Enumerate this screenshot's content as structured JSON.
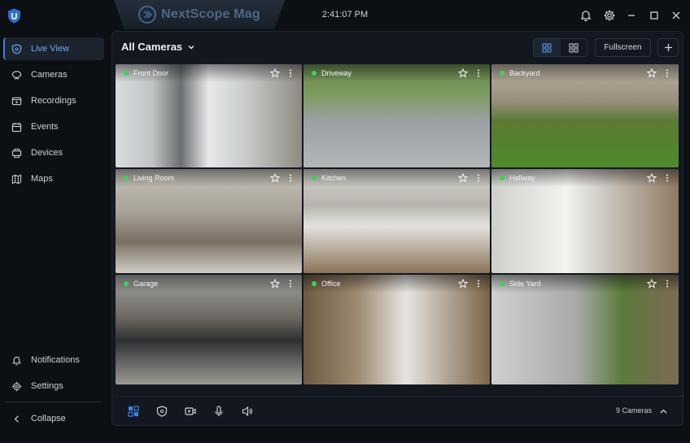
{
  "app": {
    "brand_name": "NextScope Mag",
    "clock": "2:41:07 PM",
    "accent": "#3e84e6",
    "status_online_color": "#3fd15a"
  },
  "topbar": {
    "icons": [
      "bell-icon",
      "gear-icon",
      "minimize-icon",
      "maximize-icon",
      "close-icon"
    ]
  },
  "sidebar": {
    "items": [
      {
        "label": "Live View",
        "icon": "shield-icon",
        "active": true
      },
      {
        "label": "Cameras",
        "icon": "camera-icon"
      },
      {
        "label": "Recordings",
        "icon": "recordings-icon"
      },
      {
        "label": "Events",
        "icon": "events-icon"
      },
      {
        "label": "Devices",
        "icon": "devices-icon"
      },
      {
        "label": "Maps",
        "icon": "map-icon"
      }
    ],
    "bottom_items": [
      {
        "label": "Notifications",
        "icon": "bell-icon"
      },
      {
        "label": "Settings",
        "icon": "gear-icon"
      }
    ],
    "collapse_label": "Collapse"
  },
  "main": {
    "title": "All Cameras",
    "fullscreen_label": "Fullscreen",
    "cameras": [
      {
        "name": "Front Door",
        "status": "online"
      },
      {
        "name": "Driveway",
        "status": "online"
      },
      {
        "name": "Backyard",
        "status": "online"
      },
      {
        "name": "Living Room",
        "status": "online"
      },
      {
        "name": "Kitchen",
        "status": "online"
      },
      {
        "name": "Hallway",
        "status": "online"
      },
      {
        "name": "Garage",
        "status": "online"
      },
      {
        "name": "Office",
        "status": "online"
      },
      {
        "name": "Side Yard",
        "status": "online"
      }
    ],
    "camera_count_label": "9 Cameras"
  },
  "bottom_bar": {
    "icons": [
      "grid-layout-icon",
      "shield-icon",
      "record-icon",
      "microphone-icon",
      "speaker-icon"
    ]
  }
}
